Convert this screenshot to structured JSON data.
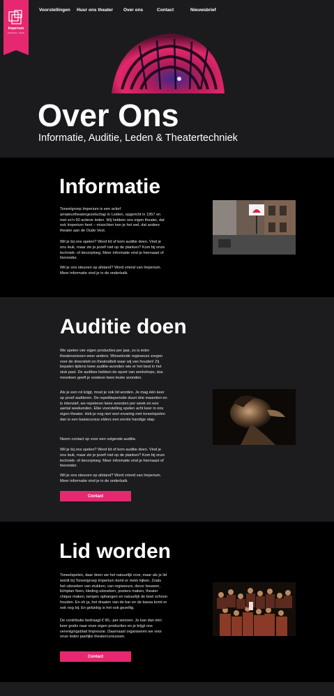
{
  "nav": {
    "items": [
      {
        "label": "Voorstellingen"
      },
      {
        "label": "Huur ons theater"
      },
      {
        "label": "Over ons"
      },
      {
        "label": "Contact"
      },
      {
        "label": "Nieuwsbrief"
      }
    ]
  },
  "logo": {
    "name": "Imperium",
    "tagline": "toneelgroep · theater"
  },
  "hero": {
    "title": "Over Ons",
    "subtitle": "Informatie, Auditie, Leden & Theatertechniek"
  },
  "informatie": {
    "title": "Informatie",
    "paragraphs": [
      "Toneelgroep Imperium is een actief amateurtheatergezelschap in Leiden, opgericht in 1957 en met zo'n 60 actieve leden. Wij hebben ons eigen theater, dat ook Imperium heet – misschien ken je het wel, dat andere theater aan de Oude Vest.",
      "Wil je bij ons spelen? Word lid of kom auditie doen. Vind je ons leuk, maar zie je jezelf niet op de planken? Kom bij onze techniek- of decorploeg. Meer informatie vind je hiernaast of hieronder.",
      "Wil je ons steunen op afstand? Word vriend van Imperium. Meer informatie vind je in de onderbalk."
    ]
  },
  "auditie": {
    "title": "Auditie doen",
    "paragraphs": [
      "We spelen vier eigen producties per jaar, zo is ieder theaterseizoen weer anders. Wisselende regisseurs zorgen voor de diversiteit en theatraliteit waar wij van houden! Zij bepalen tijdens twee auditie-avonden wie er het best in het stuk past. De audities hebben de opzet van workshops, dus meedoen geeft je sowieso twee leuke avonden.",
      "Als je een rol krijgt, moet je ook lid worden. Je mag één keer op proef auditeren. De repetitieperiode duurt drie maanden en is intensief, we repeteren twee avonden per week en een aantal weekenden. Elke voorstelling spelen acht keer in ons eigen theater. Heb je nog niet veel ervaring met toneelspelen dan is een basiscursus elders een eerste handige stap.",
      "Neem contact op voor een volgende auditie.",
      "Wil je bij ons spelen? Word lid of kom auditie doen. Vind je ons leuk, maar zie je jezelf niet op de planken? Kom bij onze techniek- of decorploeg. Meer informatie vind je hiernaast of hieronder.",
      "Wil je ons steunen op afstand? Word vriend van Imperium. Meer informatie vind je in de onderbalk."
    ],
    "button": "Contact"
  },
  "lid": {
    "title": "Lid worden",
    "paragraphs": [
      "Toneelspelen, daar doen we het natuurlijk voor, maar als je lid wordt bij Toneelgroep Imperium komt er méér kijken. Zoals het uitzoeken van stukken, van regisseurs, decor bouwen, lichtplan fixen, kleding uitzoeken, posters maken, theater chique maken, lampen ophangen en natuurlijk de boel schoon houden. En oh ja, het draaien van de bar en de kassa komt er ook nog bij. En gelukkig is het ook gezellig.",
      "De contributie bedraagt € 90,- per seizoen. Je kan dan één keer gratis naar onze eigen producties en je krijgt ons verenigingsblad Impressie. Daarnaast organiseren we voor onze leden jaarlijks theatercursussen."
    ],
    "button": "Contact"
  },
  "colors": {
    "accent": "#e5286f",
    "dark": "#1c1c1e",
    "black": "#000000"
  }
}
